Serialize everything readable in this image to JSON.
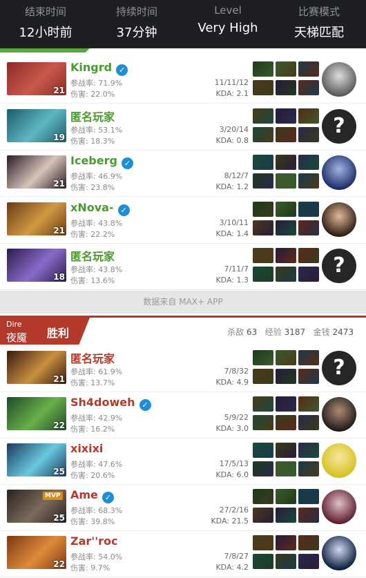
{
  "header": [
    {
      "label": "结束时间",
      "value": "12小时前"
    },
    {
      "label": "持续时间",
      "value": "37分钟"
    },
    {
      "label": "Level",
      "value": "Very High"
    },
    {
      "label": "比赛模式",
      "value": "天梯匹配"
    }
  ],
  "radiant_players": [
    {
      "name": "Kingrd",
      "verified": true,
      "level": "21",
      "participation": "参战率: 71.9%",
      "damage": "伤害: 22.0%",
      "kda_nums": "11/11/12",
      "kda": "KDA: 2.1",
      "name_color": "#4a9b2e",
      "hero_colors": [
        "#8a2a2a",
        "#c8594a"
      ],
      "avatar": "photo",
      "avatar_colors": [
        "#555",
        "#ddd"
      ]
    },
    {
      "name": "匿名玩家",
      "verified": false,
      "level": "19",
      "participation": "参战率: 53.1%",
      "damage": "伤害: 18.3%",
      "kda_nums": "3/20/14",
      "kda": "KDA: 0.8",
      "name_color": "#4a9b2e",
      "hero_colors": [
        "#1e5a6a",
        "#5fb7c4"
      ],
      "avatar": "anon"
    },
    {
      "name": "Iceberg",
      "verified": true,
      "level": "21",
      "participation": "参战率: 46.9%",
      "damage": "伤害: 23.8%",
      "kda_nums": "8/12/7",
      "kda": "KDA: 1.2",
      "name_color": "#4a9b2e",
      "hero_colors": [
        "#2a1a26",
        "#d6c4b8"
      ],
      "avatar": "photo",
      "avatar_colors": [
        "#1a2a66",
        "#9fb4e0"
      ]
    },
    {
      "name": "xNova-",
      "verified": true,
      "level": "21",
      "participation": "参战率: 43.8%",
      "damage": "伤害: 22.2%",
      "kda_nums": "3/10/11",
      "kda": "KDA: 1.4",
      "name_color": "#4a9b2e",
      "hero_colors": [
        "#6a3a14",
        "#d09a44"
      ],
      "avatar": "photo",
      "avatar_colors": [
        "#2a1a10",
        "#e0b89a"
      ]
    },
    {
      "name": "匿名玩家",
      "verified": false,
      "level": "18",
      "participation": "参战率: 43.8%",
      "damage": "伤害: 13.6%",
      "kda_nums": "7/11/7",
      "kda": "KDA: 1.3",
      "name_color": "#4a9b2e",
      "hero_colors": [
        "#2a1e4a",
        "#8a6ac8"
      ],
      "avatar": "anon"
    }
  ],
  "divider_text": "数据来自 MAX+ APP",
  "dire": {
    "side": "Dire",
    "name": "夜魇",
    "result": "胜利",
    "kills_label": "杀敌",
    "kills": "63",
    "xp_label": "经验",
    "xp": "3187",
    "gold_label": "金钱",
    "gold": "2473"
  },
  "dire_players": [
    {
      "name": "匿名玩家",
      "verified": false,
      "mvp": false,
      "level": "21",
      "participation": "参战率: 61.9%",
      "damage": "伤害: 13.7%",
      "kda_nums": "7/8/32",
      "kda": "KDA: 4.9",
      "name_color": "#b33a2b",
      "hero_colors": [
        "#3a1a10",
        "#c89040"
      ],
      "avatar": "anon"
    },
    {
      "name": "Sh4doweh",
      "verified": true,
      "mvp": false,
      "level": "22",
      "participation": "参战率: 42.9%",
      "damage": "伤害: 16.2%",
      "kda_nums": "5/9/22",
      "kda": "KDA: 3.0",
      "name_color": "#b33a2b",
      "hero_colors": [
        "#1e4a2a",
        "#6ab04a"
      ],
      "avatar": "photo",
      "avatar_colors": [
        "#1a1a1a",
        "#b08a70"
      ]
    },
    {
      "name": "xixixi",
      "verified": false,
      "mvp": false,
      "level": "25",
      "participation": "参战率: 47.6%",
      "damage": "伤害: 20.6%",
      "kda_nums": "17/5/13",
      "kda": "KDA: 6.0",
      "name_color": "#b33a2b",
      "hero_colors": [
        "#1a3a5a",
        "#6ac8e0"
      ],
      "avatar": "photo",
      "avatar_colors": [
        "#d8c020",
        "#f4e8a0"
      ]
    },
    {
      "name": "Ame",
      "verified": true,
      "mvp": true,
      "mvp_label": "MVP",
      "level": "25",
      "participation": "参战率: 68.3%",
      "damage": "伤害: 39.8%",
      "kda_nums": "27/2/16",
      "kda": "KDA: 21.5",
      "name_color": "#b33a2b",
      "hero_colors": [
        "#2a2420",
        "#7a6a5a"
      ],
      "avatar": "photo",
      "avatar_colors": [
        "#5a1a2a",
        "#e0c0c8"
      ]
    },
    {
      "name": "Zar''roc",
      "verified": false,
      "mvp": false,
      "level": "22",
      "participation": "参战率: 54.0%",
      "damage": "伤害: 9.7%",
      "kda_nums": "7/8/27",
      "kda": "KDA: 4.2",
      "name_color": "#b33a2b",
      "hero_colors": [
        "#7a3a14",
        "#e08a3a"
      ],
      "avatar": "photo",
      "avatar_colors": [
        "#0a1a3a",
        "#d0d8f0"
      ]
    }
  ],
  "colors": {
    "radiant_green": "#4a9b2e",
    "dire_red": "#b33a2b",
    "header_bg": "#1d1f22",
    "verified_blue": "#1f8ed6",
    "mvp_orange": "#d88b1e"
  }
}
